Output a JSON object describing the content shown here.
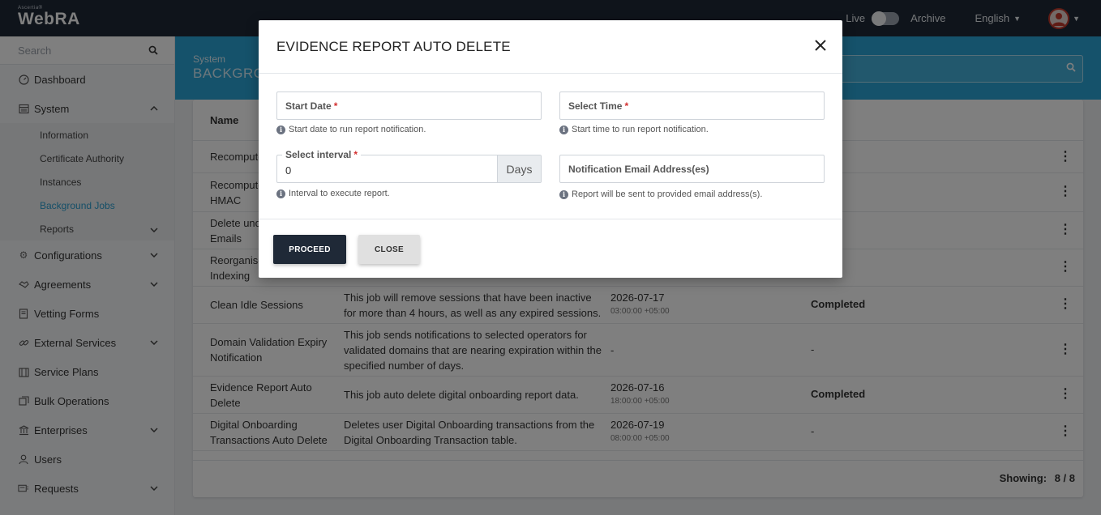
{
  "app": {
    "brand_small": "Ascertia®",
    "brand_main": "WebRA"
  },
  "topbar": {
    "live_label": "Live",
    "archive_label": "Archive",
    "language": "English"
  },
  "sidebar": {
    "search_placeholder": "Search",
    "items": [
      {
        "label": "Dashboard",
        "icon": "dashboard-icon"
      },
      {
        "label": "System",
        "icon": "system-icon",
        "expanded": true
      },
      {
        "label": "Configurations",
        "icon": "gear-icon"
      },
      {
        "label": "Agreements",
        "icon": "handshake-icon"
      },
      {
        "label": "Vetting Forms",
        "icon": "form-icon"
      },
      {
        "label": "External Services",
        "icon": "link-icon"
      },
      {
        "label": "Service Plans",
        "icon": "plan-icon"
      },
      {
        "label": "Bulk Operations",
        "icon": "bulk-icon"
      },
      {
        "label": "Enterprises",
        "icon": "bank-icon"
      },
      {
        "label": "Users",
        "icon": "user-icon"
      },
      {
        "label": "Requests",
        "icon": "requests-icon"
      }
    ],
    "system_sub": [
      {
        "label": "Information"
      },
      {
        "label": "Certificate Authority"
      },
      {
        "label": "Instances"
      },
      {
        "label": "Background Jobs",
        "active": true
      },
      {
        "label": "Reports"
      }
    ]
  },
  "page": {
    "breadcrumb": "System",
    "title": "BACKGRO"
  },
  "table": {
    "header_name": "Name",
    "rows": [
      {
        "name": "Recompute",
        "desc": "",
        "date": "",
        "time": "",
        "status": ""
      },
      {
        "name": "Recompute HMAC",
        "desc": "",
        "date": "",
        "time": "",
        "status": ""
      },
      {
        "name": "Delete und Emails",
        "desc": "",
        "date": "",
        "time": "",
        "status": ""
      },
      {
        "name": "Reorganise Indexing",
        "desc": "",
        "date": "",
        "time": "",
        "status": ""
      },
      {
        "name": "Clean Idle Sessions",
        "desc": "This job will remove sessions that have been inactive for more than 4 hours, as well as any expired sessions.",
        "date": "2026-07-17",
        "time": "03:00:00 +05:00",
        "status": "Completed"
      },
      {
        "name": "Domain Validation Expiry Notification",
        "desc": "This job sends notifications to selected operators for validated domains that are nearing expiration within the specified number of days.",
        "date": "-",
        "time": "",
        "status": "-"
      },
      {
        "name": "Evidence Report Auto Delete",
        "desc": "This job auto delete digital onboarding report data.",
        "date": "2026-07-16",
        "time": "18:00:00 +05:00",
        "status": "Completed"
      },
      {
        "name": "Digital Onboarding Transactions Auto Delete",
        "desc": "Deletes user Digital Onboarding transactions from the Digital Onboarding Transaction table.",
        "date": "2026-07-19",
        "time": "08:00:00 +05:00",
        "status": "-"
      }
    ],
    "showing_label": "Showing:",
    "showing_value": "8 / 8"
  },
  "modal": {
    "title": "EVIDENCE REPORT AUTO DELETE",
    "start_date_label": "Start Date",
    "start_date_hint": "Start date to run report notification.",
    "select_time_label": "Select Time",
    "select_time_hint": "Start time to run report notification.",
    "interval_label": "Select interval",
    "interval_value": "0",
    "interval_unit": "Days",
    "interval_hint": "Interval to execute report.",
    "email_placeholder": "Notification Email Address(es)",
    "email_hint": "Report will be sent to provided email address(s).",
    "proceed_label": "PROCEED",
    "close_label": "CLOSE",
    "required_mark": "*"
  }
}
